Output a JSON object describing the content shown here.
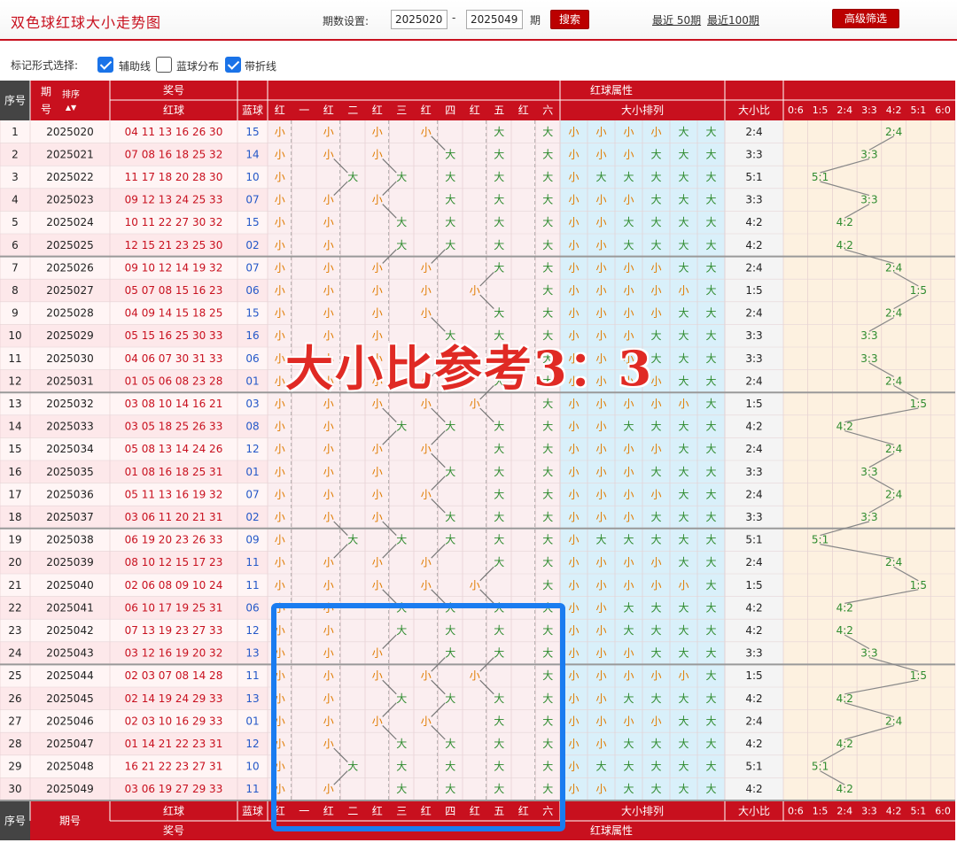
{
  "header": {
    "title": "双色球红球大小走势图",
    "period_label": "期数设置:",
    "start_period": "2025020",
    "end_period": "2025049",
    "dash": "-",
    "period_unit": "期",
    "search_button": "搜索",
    "recent_50": "最近 50期",
    "recent_100": "最近100期",
    "advanced_button": "高级筛选"
  },
  "marks": {
    "label": "标记形式选择:",
    "options": [
      {
        "label": "辅助线",
        "checked": true
      },
      {
        "label": "蓝球分布",
        "checked": false
      },
      {
        "label": "带折线",
        "checked": true
      }
    ]
  },
  "table": {
    "h_index": "序号",
    "h_period": "期",
    "h_period2": "号",
    "h_sort": "排序",
    "h_award": "奖号",
    "h_red": "红球",
    "h_blue": "蓝球",
    "h_attr": "红球属性",
    "pos_headers": [
      "红",
      "一",
      "红",
      "二",
      "红",
      "三",
      "红",
      "四",
      "红",
      "五",
      "红",
      "六"
    ],
    "h_size_arrange": "大小排列",
    "h_ratio": "大小比",
    "ratio_cols": [
      "0:6",
      "1:5",
      "2:4",
      "3:3",
      "4:2",
      "5:1",
      "6:0"
    ],
    "rows": [
      {
        "i": "1",
        "p": "2025020",
        "red": "04 11 13 16 26 30",
        "blue": "15"
      },
      {
        "i": "2",
        "p": "2025021",
        "red": "07 08 16 18 25 32",
        "blue": "14"
      },
      {
        "i": "3",
        "p": "2025022",
        "red": "11 17 18 20 28 30",
        "blue": "10"
      },
      {
        "i": "4",
        "p": "2025023",
        "red": "09 12 13 24 25 33",
        "blue": "07"
      },
      {
        "i": "5",
        "p": "2025024",
        "red": "10 11 22 27 30 32",
        "blue": "15"
      },
      {
        "i": "6",
        "p": "2025025",
        "red": "12 15 21 23 25 30",
        "blue": "02"
      },
      {
        "i": "7",
        "p": "2025026",
        "red": "09 10 12 14 19 32",
        "blue": "07"
      },
      {
        "i": "8",
        "p": "2025027",
        "red": "05 07 08 15 16 23",
        "blue": "06"
      },
      {
        "i": "9",
        "p": "2025028",
        "red": "04 09 14 15 18 25",
        "blue": "15"
      },
      {
        "i": "10",
        "p": "2025029",
        "red": "05 15 16 25 30 33",
        "blue": "16"
      },
      {
        "i": "11",
        "p": "2025030",
        "red": "04 06 07 30 31 33",
        "blue": "06"
      },
      {
        "i": "12",
        "p": "2025031",
        "red": "01 05 06 08 23 28",
        "blue": "01"
      },
      {
        "i": "13",
        "p": "2025032",
        "red": "03 08 10 14 16 21",
        "blue": "03"
      },
      {
        "i": "14",
        "p": "2025033",
        "red": "03 05 18 25 26 33",
        "blue": "08"
      },
      {
        "i": "15",
        "p": "2025034",
        "red": "05 08 13 14 24 26",
        "blue": "12"
      },
      {
        "i": "16",
        "p": "2025035",
        "red": "01 08 16 18 25 31",
        "blue": "01"
      },
      {
        "i": "17",
        "p": "2025036",
        "red": "05 11 13 16 19 32",
        "blue": "07"
      },
      {
        "i": "18",
        "p": "2025037",
        "red": "03 06 11 20 21 31",
        "blue": "02"
      },
      {
        "i": "19",
        "p": "2025038",
        "red": "06 19 20 23 26 33",
        "blue": "09"
      },
      {
        "i": "20",
        "p": "2025039",
        "red": "08 10 12 15 17 23",
        "blue": "11"
      },
      {
        "i": "21",
        "p": "2025040",
        "red": "02 06 08 09 10 24",
        "blue": "11"
      },
      {
        "i": "22",
        "p": "2025041",
        "red": "06 10 17 19 25 31",
        "blue": "06"
      },
      {
        "i": "23",
        "p": "2025042",
        "red": "07 13 19 23 27 33",
        "blue": "12"
      },
      {
        "i": "24",
        "p": "2025043",
        "red": "03 12 16 19 20 32",
        "blue": "13"
      },
      {
        "i": "25",
        "p": "2025044",
        "red": "02 03 07 08 14 28",
        "blue": "11"
      },
      {
        "i": "26",
        "p": "2025045",
        "red": "02 14 19 24 29 33",
        "blue": "13"
      },
      {
        "i": "27",
        "p": "2025046",
        "red": "02 03 10 16 29 33",
        "blue": "01"
      },
      {
        "i": "28",
        "p": "2025047",
        "red": "01 14 21 22 23 31",
        "blue": "12"
      },
      {
        "i": "29",
        "p": "2025048",
        "red": "16 21 22 23 27 31",
        "blue": "10"
      },
      {
        "i": "30",
        "p": "2025049",
        "red": "03 06 19 27 29 33",
        "blue": "11"
      }
    ],
    "big": "大",
    "small": "小",
    "f_index": "序号",
    "f_period": "期号",
    "f_red": "红球",
    "f_blue": "蓝球",
    "f_award": "奖号",
    "f_attr": "红球属性",
    "f_size_arrange": "大小排列",
    "f_ratio": "大小比"
  },
  "watermark": "大小比参考3：3",
  "colors": {
    "red": "#c8101e",
    "big": "#2e8b2e",
    "small": "#e07b00",
    "blue": "#2458c8",
    "highlight": "#1a7cf0"
  }
}
